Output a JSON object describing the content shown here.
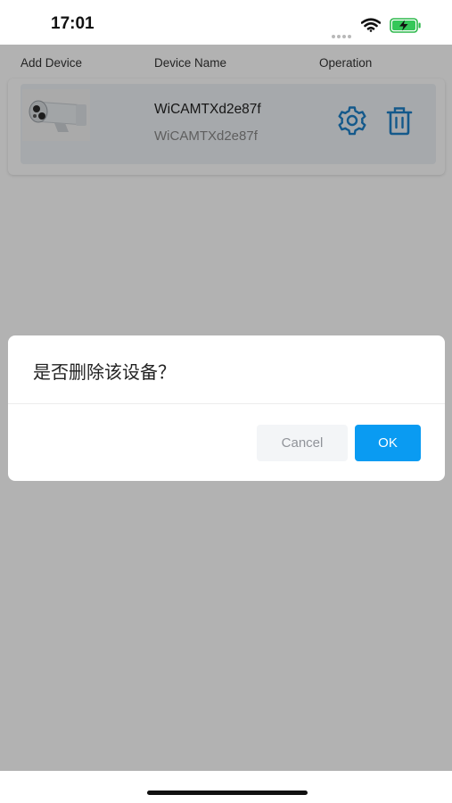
{
  "status_bar": {
    "time": "17:01"
  },
  "table_header": {
    "add_device": "Add Device",
    "device_name": "Device Name",
    "operation": "Operation"
  },
  "devices": [
    {
      "name": "WiCAMTXd2e87f",
      "id": "WiCAMTXd2e87f",
      "thumbnail_icon": "camera-icon",
      "operations": [
        "gear-icon",
        "trash-icon"
      ]
    }
  ],
  "dialog": {
    "message": "是否删除该设备？",
    "cancel_label": "Cancel",
    "ok_label": "OK"
  },
  "colors": {
    "accent": "#0a9bf2",
    "icon_blue": "#1e80c8",
    "overlay": "rgba(0,0,0,0.3)"
  }
}
